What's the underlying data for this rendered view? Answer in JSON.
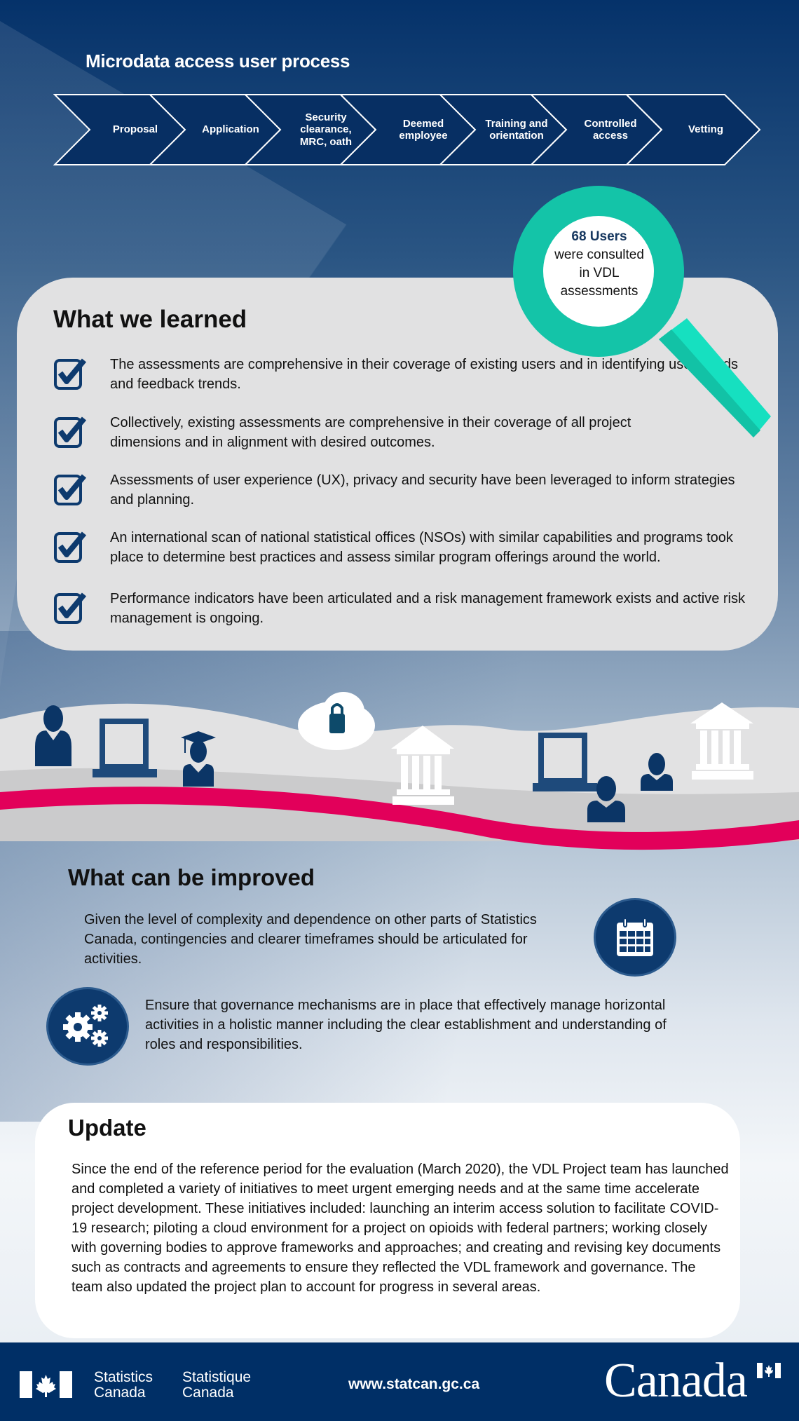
{
  "process": {
    "title": "Microdata access user process",
    "steps": [
      [
        "Proposal"
      ],
      [
        "Application"
      ],
      [
        "Security",
        "clearance,",
        "MRC, oath"
      ],
      [
        "Deemed",
        "employee"
      ],
      [
        "Training and",
        "orientation"
      ],
      [
        "Controlled",
        "access"
      ],
      [
        "Vetting"
      ]
    ]
  },
  "magnifier": {
    "highlight": "68 Users",
    "line1": "were consulted",
    "line2": "in VDL",
    "line3": "assessments"
  },
  "learned": {
    "title": "What we learned",
    "items": [
      "The assessments are comprehensive in their coverage of existing users and in identifying user needs and feedback trends.",
      "Collectively, existing assessments are comprehensive in their coverage of all project dimensions and in alignment with desired outcomes.",
      "Assessments of user experience (UX), privacy and security have been leveraged to inform strategies and planning.",
      "An international scan of national statistical offices (NSOs) with similar capabilities and programs took place to determine best practices and assess similar program offerings around the world.",
      "Performance indicators have been articulated and a risk management framework exists and active risk management is ongoing."
    ]
  },
  "improved": {
    "title": "What can be improved",
    "items": [
      {
        "text": "Given the level of complexity and dependence on other parts of Statistics Canada, contingencies and clearer timeframes should be articulated for activities.",
        "icon": "calendar-icon"
      },
      {
        "text": "Ensure that governance mechanisms are in place that effectively manage horizontal activities in a holistic manner including the clear establishment and understanding of roles and responsibilities.",
        "icon": "gears-icon"
      }
    ]
  },
  "update": {
    "title": "Update",
    "text": "Since the end of the reference period for the evaluation (March 2020), the VDL Project team has launched and completed a variety of initiatives to meet urgent emerging needs and at the same time accelerate project development. These initiatives included: launching an interim access solution to facilitate COVID-19 research; piloting a cloud environment for a project on opioids with federal partners; working closely with governing bodies to approve frameworks and approaches; and creating and revising key documents such as contracts and agreements to ensure they reflected the VDL framework and governance. The team also updated the project plan to account for progress in several areas."
  },
  "footer": {
    "agency_en_1": "Statistics",
    "agency_en_2": "Canada",
    "agency_fr_1": "Statistique",
    "agency_fr_2": "Canada",
    "url": "www.statcan.gc.ca",
    "wordmark": "Canada"
  },
  "colors": {
    "navy": "#002f66",
    "teal": "#14c4a8",
    "magenta": "#e2005a",
    "panel": "#e1e1e2"
  }
}
